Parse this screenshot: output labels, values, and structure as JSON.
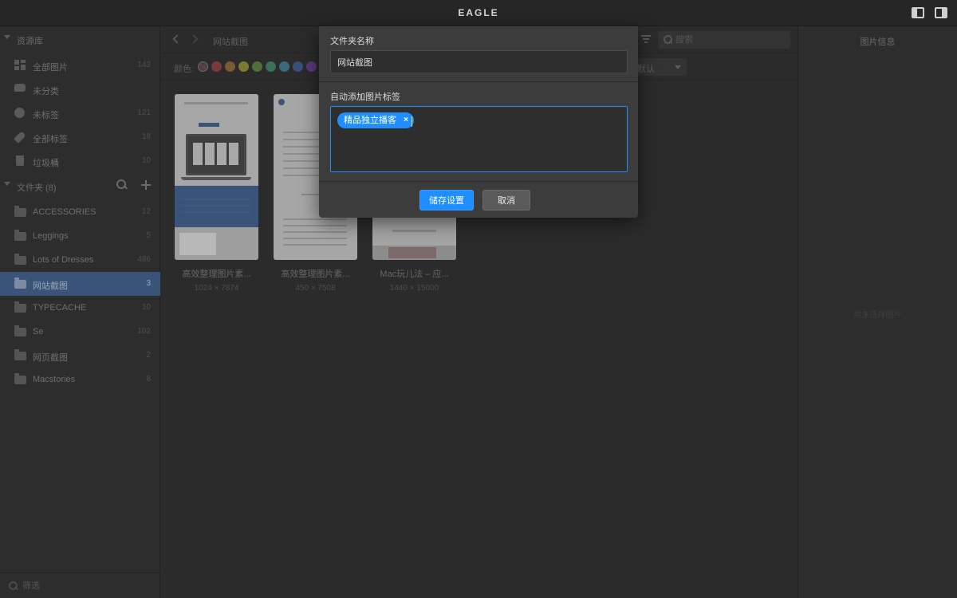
{
  "app": {
    "title": "EAGLE"
  },
  "sidebar": {
    "library_header": "资源库",
    "library_items": [
      {
        "label": "全部图片",
        "count": "143"
      },
      {
        "label": "未分类",
        "count": ""
      },
      {
        "label": "未标签",
        "count": "121"
      },
      {
        "label": "全部标签",
        "count": "18"
      },
      {
        "label": "垃圾桶",
        "count": "10"
      }
    ],
    "folders_header": "文件夹 (8)",
    "folders": [
      {
        "label": "ACCESSORIES",
        "count": "12"
      },
      {
        "label": "Leggings",
        "count": "5"
      },
      {
        "label": "Lots of Dresses",
        "count": "486"
      },
      {
        "label": "网站截图",
        "count": "3"
      },
      {
        "label": "TYPECACHE",
        "count": "10"
      },
      {
        "label": "Se",
        "count": "102"
      },
      {
        "label": "网页截图",
        "count": "2"
      },
      {
        "label": "Macstories",
        "count": "8"
      }
    ],
    "filter_placeholder": "筛选"
  },
  "toolbar": {
    "breadcrumb": "网站截图",
    "search_placeholder": "搜索",
    "color_label": "颜色:",
    "swatch_colors": [
      "#444444",
      "#7a3a3a",
      "#7a5a32",
      "#7a7a34",
      "#4f6f3a",
      "#3a6f5a",
      "#3a6a7a",
      "#3a4f7a",
      "#5a3a7a",
      "#7a3a66"
    ],
    "sort_value": "默认"
  },
  "grid": {
    "items": [
      {
        "title": "高效整理图片素...",
        "dimensions": "1024 × 7874"
      },
      {
        "title": "高效整理图片素...",
        "dimensions": "450 × 7508"
      },
      {
        "title": "Mac玩儿法 – 应...",
        "dimensions": "1440 × 15000"
      }
    ]
  },
  "info_panel": {
    "title": "图片信息",
    "empty_text": "尚未选择图片"
  },
  "dialog": {
    "folder_name_label": "文件夹名称",
    "folder_name_value": "网站截图",
    "auto_tag_label": "自动添加图片标签",
    "tags": [
      "精品独立播客"
    ],
    "save_label": "储存设置",
    "cancel_label": "取消",
    "accent_color": "#1f8fff"
  }
}
